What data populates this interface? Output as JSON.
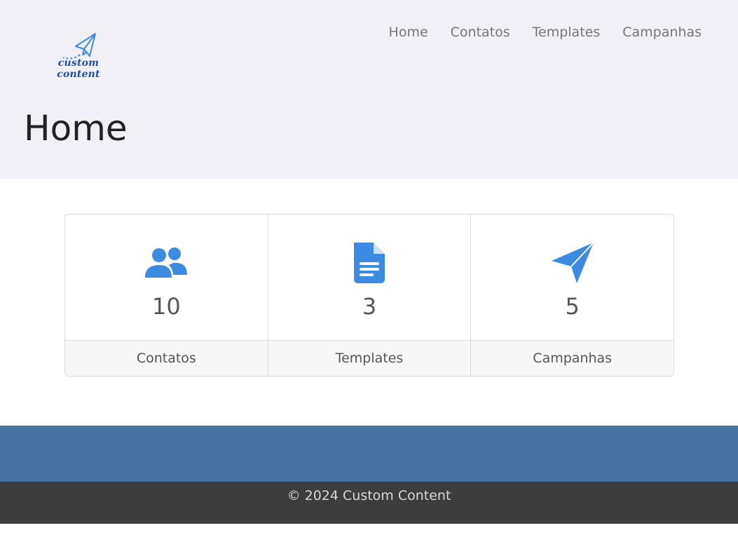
{
  "brand": {
    "logo_text": "custom content",
    "icon": "paper-plane-icon",
    "color": "#1f4fa0"
  },
  "nav": {
    "items": [
      {
        "label": "Home"
      },
      {
        "label": "Contatos"
      },
      {
        "label": "Templates"
      },
      {
        "label": "Campanhas"
      }
    ]
  },
  "page": {
    "title": "Home"
  },
  "stats": [
    {
      "icon": "users-icon",
      "count": "10",
      "label": "Contatos"
    },
    {
      "icon": "document-icon",
      "count": "3",
      "label": "Templates"
    },
    {
      "icon": "paper-plane-icon",
      "count": "5",
      "label": "Campanhas"
    }
  ],
  "colors": {
    "accent": "#3d8be0",
    "footer_blue": "#4671a3",
    "footer_dark": "#3d3d3d"
  },
  "footer": {
    "copyright": "© 2024 Custom Content"
  }
}
